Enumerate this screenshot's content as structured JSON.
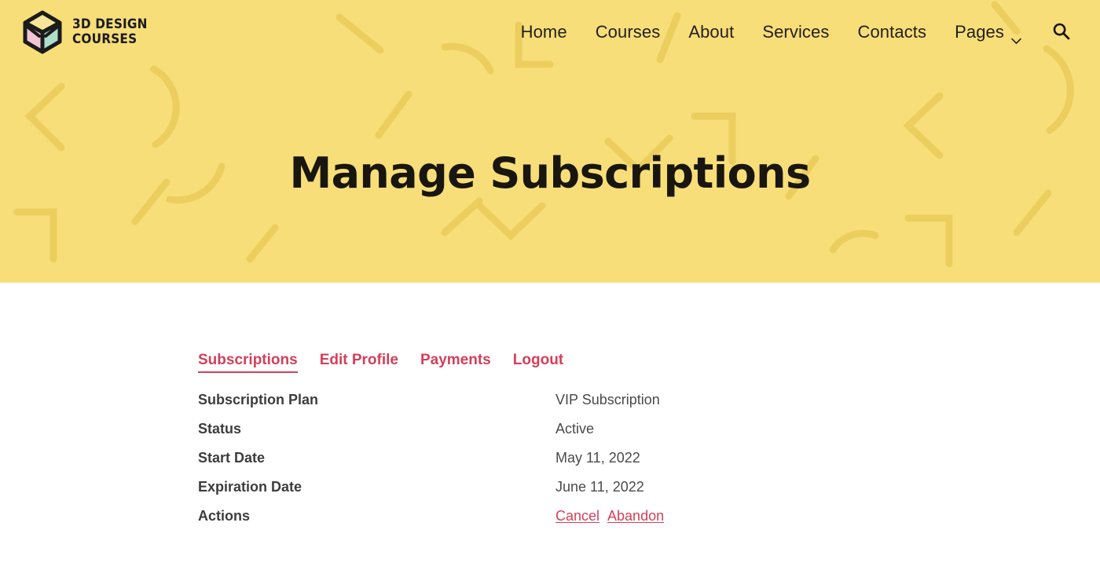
{
  "theme": {
    "hero_bg": "#f7de79",
    "deco_color": "#eed060",
    "accent": "#d43f5a",
    "text_dark": "#19160f",
    "label_color": "#3d3d3d",
    "value_color": "#4a4a4a",
    "page_bg": "#ffffff"
  },
  "header": {
    "brand": {
      "name": "3D DESIGN\nCOURSES",
      "logo_icon": "cube-icon",
      "cube_colors": {
        "top": "#f7e59a",
        "left": "#f2c4d6",
        "right": "#aedfcb",
        "outline": "#1b1b1b"
      }
    },
    "nav": [
      {
        "label": "Home",
        "icon": null
      },
      {
        "label": "Courses",
        "icon": null
      },
      {
        "label": "About",
        "icon": null
      },
      {
        "label": "Services",
        "icon": null
      },
      {
        "label": "Contacts",
        "icon": null
      },
      {
        "label": "Pages",
        "icon": "chevron-down-icon"
      }
    ],
    "search_icon": "search-icon"
  },
  "hero": {
    "title": "Manage Subscriptions"
  },
  "account": {
    "tabs": [
      {
        "label": "Subscriptions",
        "active": true
      },
      {
        "label": "Edit Profile",
        "active": false
      },
      {
        "label": "Payments",
        "active": false
      },
      {
        "label": "Logout",
        "active": false
      }
    ],
    "details": [
      {
        "label": "Subscription Plan",
        "value": "VIP Subscription"
      },
      {
        "label": "Status",
        "value": "Active"
      },
      {
        "label": "Start Date",
        "value": "May 11, 2022"
      },
      {
        "label": "Expiration Date",
        "value": "June 11, 2022"
      }
    ],
    "actions_label": "Actions",
    "actions": [
      {
        "label": "Cancel"
      },
      {
        "label": "Abandon"
      }
    ]
  }
}
